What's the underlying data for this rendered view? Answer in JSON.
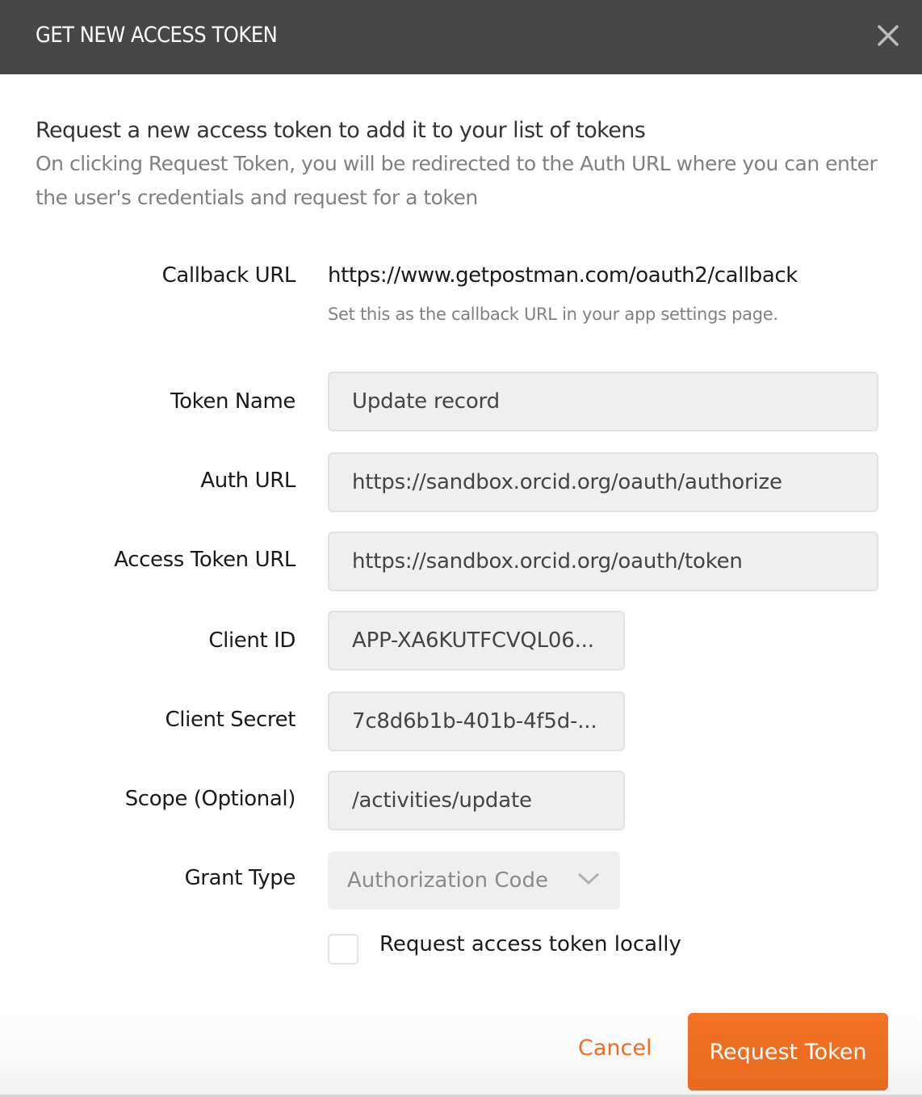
{
  "header": {
    "title": "GET NEW ACCESS TOKEN",
    "close_icon": "close-icon"
  },
  "intro": {
    "title": "Request a new access token to add it to your list of tokens",
    "description": "On clicking Request Token, you will be redirected to the Auth URL where you can enter the user's credentials and request for a token"
  },
  "callback": {
    "label": "Callback URL",
    "value": "https://www.getpostman.com/oauth2/callback",
    "hint": "Set this as the callback URL in your app settings page."
  },
  "fields": {
    "token_name": {
      "label": "Token Name",
      "value": "Update record"
    },
    "auth_url": {
      "label": "Auth URL",
      "value": "https://sandbox.orcid.org/oauth/authorize"
    },
    "access_token_url": {
      "label": "Access Token URL",
      "value": "https://sandbox.orcid.org/oauth/token"
    },
    "client_id": {
      "label": "Client ID",
      "value": "APP-XA6KUTFCVQL06..."
    },
    "client_secret": {
      "label": "Client Secret",
      "value": "7c8d6b1b-401b-4f5d-..."
    },
    "scope": {
      "label": "Scope (Optional)",
      "value": "/activities/update"
    },
    "grant_type": {
      "label": "Grant Type",
      "value": "Authorization Code",
      "icon": "chevron-down-icon"
    }
  },
  "local_request": {
    "label": "Request access token locally",
    "checked": false
  },
  "footer": {
    "cancel_label": "Cancel",
    "request_label": "Request Token"
  },
  "colors": {
    "header_bg": "#474747",
    "accent": "#f26b21",
    "field_bg": "#efefef"
  }
}
